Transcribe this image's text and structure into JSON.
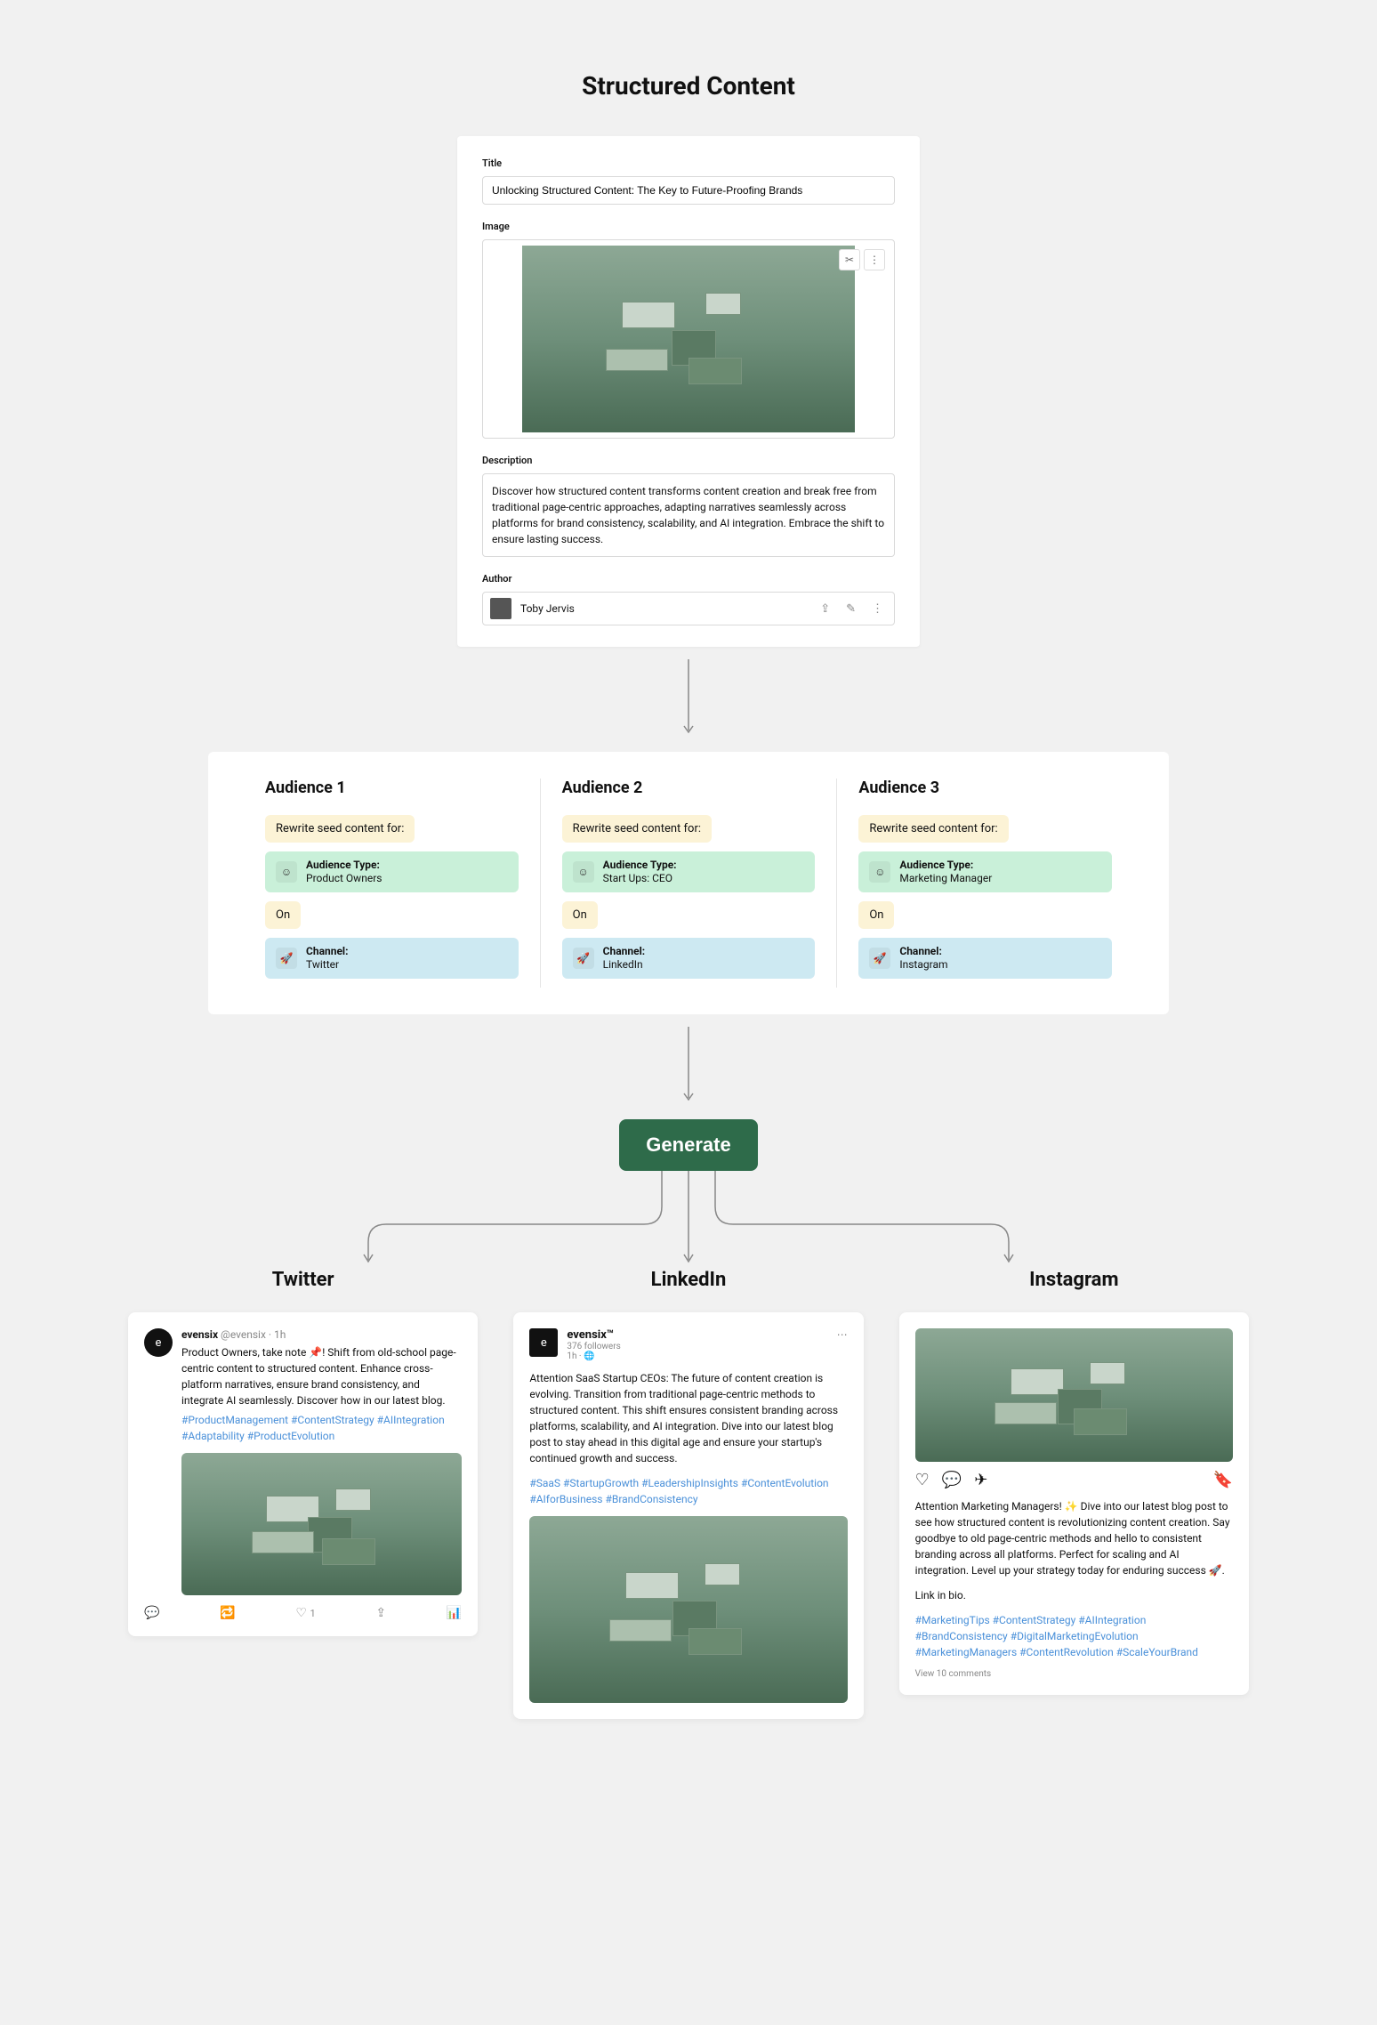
{
  "header": "Structured Content",
  "editor": {
    "title_label": "Title",
    "title_value": "Unlocking Structured Content: The Key to Future-Proofing Brands",
    "image_label": "Image",
    "description_label": "Description",
    "description_value": "Discover how structured content transforms content creation and break free from traditional page-centric approaches, adapting narratives seamlessly across platforms for brand consistency, scalability, and AI integration. Embrace the shift to ensure lasting success.",
    "author_label": "Author",
    "author_name": "Toby Jervis"
  },
  "audiences": [
    {
      "heading": "Audience 1",
      "rewrite_label": "Rewrite seed content for:",
      "audience_type_label": "Audience Type:",
      "audience_type_value": "Product Owners",
      "on_label": "On",
      "channel_label": "Channel:",
      "channel_value": "Twitter"
    },
    {
      "heading": "Audience 2",
      "rewrite_label": "Rewrite seed content for:",
      "audience_type_label": "Audience Type:",
      "audience_type_value": "Start Ups: CEO",
      "on_label": "On",
      "channel_label": "Channel:",
      "channel_value": "LinkedIn"
    },
    {
      "heading": "Audience 3",
      "rewrite_label": "Rewrite seed content for:",
      "audience_type_label": "Audience Type:",
      "audience_type_value": "Marketing Manager",
      "on_label": "On",
      "channel_label": "Channel:",
      "channel_value": "Instagram"
    }
  ],
  "generate_label": "Generate",
  "outputs": {
    "twitter": {
      "heading": "Twitter",
      "display_name": "evensix",
      "handle": "@evensix · 1h",
      "body": "Product Owners, take note 📌! Shift from old-school page-centric content to structured content. Enhance cross-platform narratives, ensure brand consistency, and integrate AI seamlessly. Discover how in our latest blog.",
      "hashtags": "#ProductManagement #ContentStrategy #AIIntegration #Adaptability #ProductEvolution",
      "like_count": "1"
    },
    "linkedin": {
      "heading": "LinkedIn",
      "display_name": "evensix™",
      "followers": "376 followers",
      "time": "1h · 🌐",
      "body": "Attention SaaS Startup CEOs: The future of content creation is evolving. Transition from traditional page-centric methods to structured content. This shift ensures consistent branding across platforms, scalability, and AI integration. Dive into our latest blog post to stay ahead in this digital age and ensure your startup's continued growth and success.",
      "hashtags": "#SaaS #StartupGrowth #LeadershipInsights #ContentEvolution #AIforBusiness #BrandConsistency"
    },
    "instagram": {
      "heading": "Instagram",
      "body": "Attention Marketing Managers! ✨ Dive into our latest blog post to see how structured content is revolutionizing content creation. Say goodbye to old page-centric methods and hello to consistent branding across all platforms. Perfect for scaling and AI integration. Level up your strategy today for enduring success 🚀.",
      "link_text": "Link in bio.",
      "hashtags": "#MarketingTips #ContentStrategy #AIIntegration #BrandConsistency #DigitalMarketingEvolution #MarketingManagers #ContentRevolution #ScaleYourBrand",
      "comments": "View 10 comments"
    }
  }
}
